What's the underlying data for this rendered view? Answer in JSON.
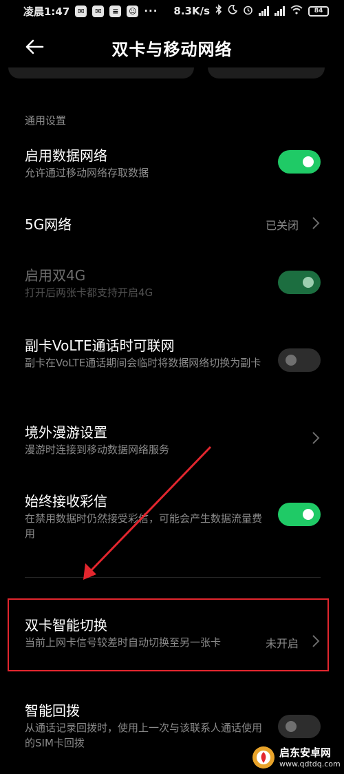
{
  "status_bar": {
    "time": "凌晨1:47",
    "notification_icons": [
      "wechat-icon",
      "wechat-icon",
      "doc-icon",
      "qq-icon"
    ],
    "more": "···",
    "net_speed": "8.3K/s",
    "battery_level": "84"
  },
  "header": {
    "title": "双卡与移动网络"
  },
  "section": {
    "title": "通用设置"
  },
  "rows": {
    "mobile_data": {
      "title": "启用数据网络",
      "subtitle": "允许通过移动网络存取数据",
      "toggle": "on"
    },
    "five_g": {
      "title": "5G网络",
      "value": "已关闭"
    },
    "dual_4g": {
      "title": "启用双4G",
      "subtitle": "打开后两张卡都支持开启4G",
      "toggle": "on",
      "disabled": true
    },
    "secondary_volte": {
      "title": "副卡VoLTE通话时可联网",
      "subtitle": "副卡在VoLTE通话期间会临时将数据网络切换为副卡",
      "toggle": "off"
    },
    "roaming": {
      "title": "境外漫游设置",
      "subtitle": "漫游时连接到移动数据网络服务"
    },
    "mms": {
      "title": "始终接收彩信",
      "subtitle": "在禁用数据时仍然接受彩信，可能会产生数据流量费用",
      "toggle": "on"
    },
    "smart_switch": {
      "title": "双卡智能切换",
      "subtitle": "当前上网卡信号较差时自动切换至另一张卡",
      "value": "未开启"
    },
    "smart_callback": {
      "title": "智能回拨",
      "subtitle": "从通话记录回拨时，使用上一次与该联系人通话使用的SIM卡回拨",
      "toggle": "off"
    }
  },
  "watermark": {
    "name": "启东安卓网",
    "url": "www.qdtdq.com"
  },
  "colors": {
    "background": "#000000",
    "toggle_on": "#1fca66",
    "toggle_off": "#2d2d2d",
    "highlight": "#e3262e"
  }
}
